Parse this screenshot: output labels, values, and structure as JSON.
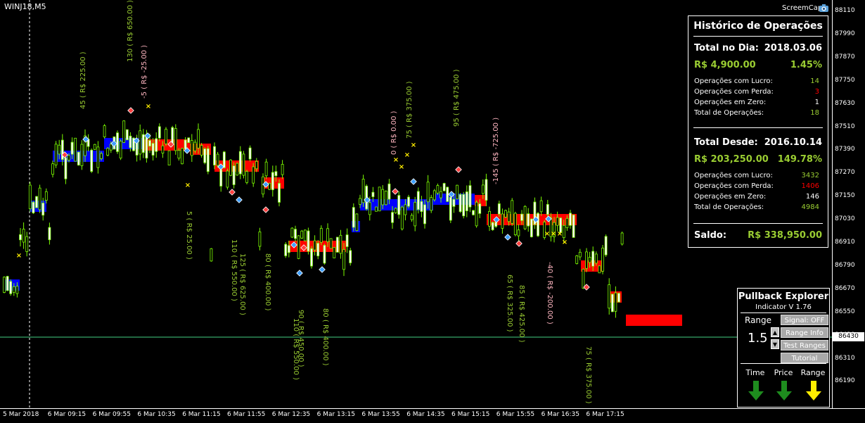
{
  "symbol": "WINJ18,M5",
  "screemcap": "ScreemCap",
  "price_ticks": [
    "88110",
    "87990",
    "87870",
    "87750",
    "87630",
    "87510",
    "87390",
    "87270",
    "87150",
    "87030",
    "86910",
    "86790",
    "86670",
    "86550",
    "86430",
    "86310",
    "86190"
  ],
  "current_price": "86430",
  "time_ticks": [
    "5 Mar 2018",
    "6 Mar 09:15",
    "6 Mar 09:55",
    "6 Mar 10:35",
    "6 Mar 11:15",
    "6 Mar 11:55",
    "6 Mar 12:35",
    "6 Mar 13:15",
    "6 Mar 13:55",
    "6 Mar 14:35",
    "6 Mar 15:15",
    "6 Mar 15:55",
    "6 Mar 16:35",
    "6 Mar 17:15"
  ],
  "trade_labels": [
    {
      "text": "45 ( R$ 225.00 )",
      "color": "#9acd32"
    },
    {
      "text": "130 ( R$ 650.00 )",
      "color": "#9acd32"
    },
    {
      "text": "-5 ( R$ -25.00 )",
      "color": "#ffb6c1"
    },
    {
      "text": "5 ( R$ 25.00 )",
      "color": "#9acd32"
    },
    {
      "text": "110 ( R$ 550.00 )",
      "color": "#9acd32"
    },
    {
      "text": "125 ( R$ 625.00 )",
      "color": "#9acd32"
    },
    {
      "text": "80 ( R$ 400.00 )",
      "color": "#9acd32"
    },
    {
      "text": "90 ( R$ 450.00 )",
      "color": "#9acd32"
    },
    {
      "text": "110 ( R$ 550.00 )",
      "color": "#9acd32"
    },
    {
      "text": "80 ( R$ 400.00 )",
      "color": "#9acd32"
    },
    {
      "text": "0 ( R$ 0.00 )",
      "color": "#ffb6c1"
    },
    {
      "text": "75 ( R$ 375.00 )",
      "color": "#9acd32"
    },
    {
      "text": "95 ( R$ 475.00 )",
      "color": "#9acd32"
    },
    {
      "text": "-145 ( R$ -725.00 )",
      "color": "#ffb6c1"
    },
    {
      "text": "65 ( R$ 325.00 )",
      "color": "#9acd32"
    },
    {
      "text": "85 ( R$ 425.00 )",
      "color": "#9acd32"
    },
    {
      "text": "-40 ( R$ -200.00 )",
      "color": "#ffb6c1"
    },
    {
      "text": "75 ( R$ 375.00 )",
      "color": "#9acd32"
    }
  ],
  "history": {
    "title": "Histórico de Operações",
    "day": {
      "label": "Total no Dia:",
      "date": "2018.03.06",
      "amount": "R$ 4,900.00",
      "percent": "1.45%",
      "stats": [
        {
          "label": "Operações com Lucro:",
          "value": "14",
          "color": "#9acd32"
        },
        {
          "label": "Operações com Perda:",
          "value": "3",
          "color": "#ff0000"
        },
        {
          "label": "Operações em Zero:",
          "value": "1",
          "color": "#ffffff"
        },
        {
          "label": "Total de Operações:",
          "value": "18",
          "color": "#9acd32"
        }
      ]
    },
    "since": {
      "label": "Total Desde:",
      "date": "2016.10.14",
      "amount": "R$ 203,250.00",
      "percent": "149.78%",
      "stats": [
        {
          "label": "Operações com Lucro:",
          "value": "3432",
          "color": "#9acd32"
        },
        {
          "label": "Operações com Perda:",
          "value": "1406",
          "color": "#ff0000"
        },
        {
          "label": "Operações em Zero:",
          "value": "146",
          "color": "#ffffff"
        },
        {
          "label": "Total de Operações:",
          "value": "4984",
          "color": "#9acd32"
        }
      ]
    },
    "balance_label": "Saldo:",
    "balance_value": "R$ 338,950.00"
  },
  "pullback": {
    "title": "Pullback Explorer",
    "subtitle": "Indicator V 1.76",
    "range_label": "Range",
    "range_value": "1.5",
    "up_arrow": "▲",
    "down_arrow": "▼",
    "buttons": [
      "Signal: OFF",
      "Range Info",
      "Test Ranges",
      "Tutorial"
    ],
    "columns": [
      "Time",
      "Price",
      "Range"
    ],
    "arrow_colors": [
      "#1e8c1e",
      "#1e8c1e",
      "#ffee00"
    ]
  },
  "colors": {
    "up_band": "#0000ff",
    "down_band": "#ff0000",
    "candle": "#7cfc00",
    "hline": "#2e8b57"
  }
}
